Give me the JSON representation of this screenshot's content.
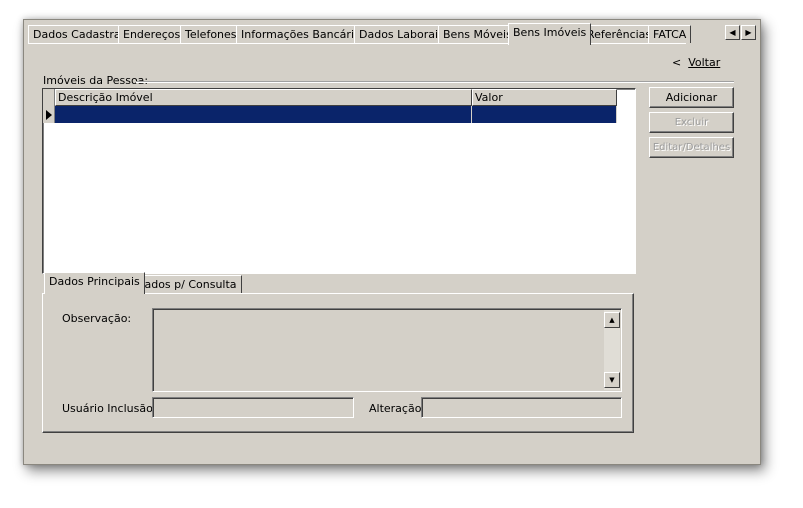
{
  "tabs": [
    {
      "label": "Dados Cadastrais",
      "active": false
    },
    {
      "label": "Endereços",
      "active": false
    },
    {
      "label": "Telefones",
      "active": false
    },
    {
      "label": "Informações Bancárias",
      "active": false
    },
    {
      "label": "Dados Laborais",
      "active": false
    },
    {
      "label": "Bens Móveis",
      "active": false
    },
    {
      "label": "Bens Imóveis",
      "active": true
    },
    {
      "label": "Referências",
      "active": false
    },
    {
      "label": "FATCA",
      "active": false
    }
  ],
  "nav": {
    "back_prefix": "<",
    "back_label": "Voltar"
  },
  "group": {
    "title": "Imóveis da Pessoa:"
  },
  "grid": {
    "columns": [
      "Descrição Imóvel",
      "Valor"
    ],
    "rows": [
      [
        "",
        ""
      ]
    ]
  },
  "buttons": {
    "add": "Adicionar",
    "delete": "Excluir",
    "edit": "Editar/Detalhes"
  },
  "subtabs": [
    {
      "label": "Dados Principais",
      "active": true
    },
    {
      "label": "Dados p/ Consulta",
      "active": false
    }
  ],
  "form": {
    "observation_label": "Observação:",
    "observation_value": "",
    "user_label": "Usuário Inclusão:",
    "user_value": "",
    "change_label": "Alteração:",
    "change_value": ""
  },
  "icons": {
    "tab_left": "arrow-left-icon",
    "tab_right": "arrow-right-icon",
    "row_pointer": "row-pointer-icon",
    "scroll_up": "scroll-up-icon",
    "scroll_down": "scroll-down-icon"
  },
  "colors": {
    "selection": "#0a246a",
    "face": "#d4d0c8"
  }
}
